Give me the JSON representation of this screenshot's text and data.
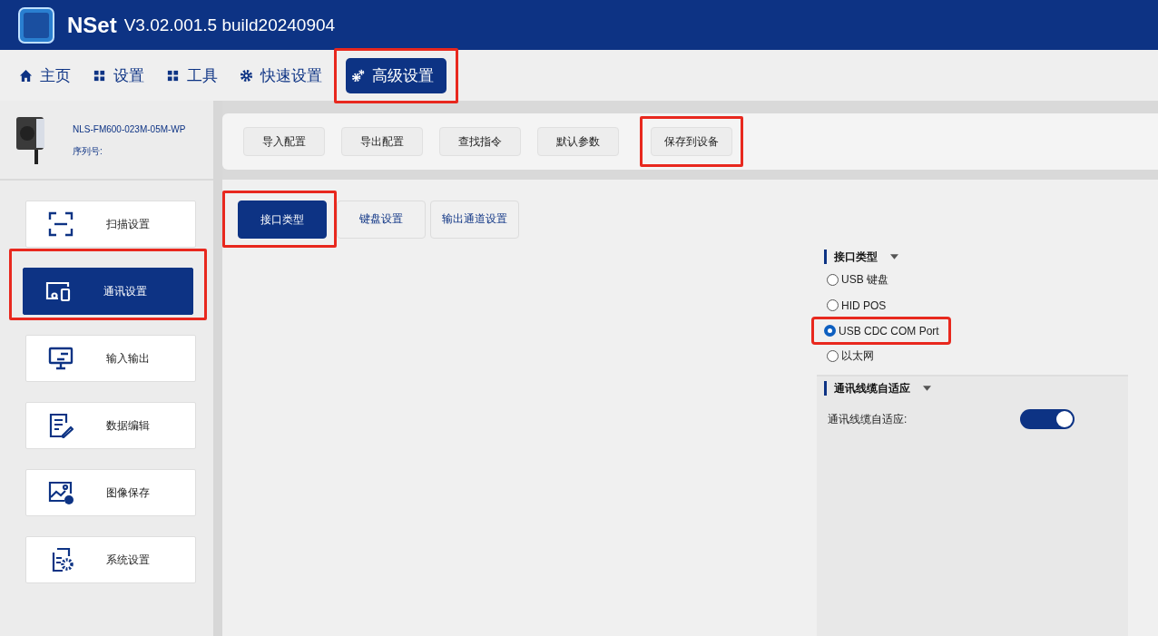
{
  "window": {
    "app_name": "NSet",
    "version": "V3.02.001.5 build20240904"
  },
  "nav": [
    {
      "kind": "home",
      "label": "主页",
      "selected": false,
      "highlighted": false
    },
    {
      "kind": "grid",
      "label": "设置",
      "selected": false,
      "highlighted": false
    },
    {
      "kind": "grid",
      "label": "工具",
      "selected": false,
      "highlighted": false
    },
    {
      "kind": "gear",
      "label": "快速设置",
      "selected": false,
      "highlighted": false
    },
    {
      "kind": "gears",
      "label": "高级设置",
      "selected": true,
      "highlighted": true
    }
  ],
  "device": {
    "model": "NLS-FM600-023M-05M-WP",
    "serial_label": "序列号:"
  },
  "sidebar": {
    "items": [
      {
        "kind": "scan",
        "label": "扫描设置",
        "selected": false,
        "highlighted": false
      },
      {
        "kind": "comm",
        "label": "通讯设置",
        "selected": true,
        "highlighted": true
      },
      {
        "kind": "io",
        "label": "输入输出",
        "selected": false,
        "highlighted": false
      },
      {
        "kind": "edit",
        "label": "数据编辑",
        "selected": false,
        "highlighted": false
      },
      {
        "kind": "image",
        "label": "图像保存",
        "selected": false,
        "highlighted": false
      },
      {
        "kind": "system",
        "label": "系统设置",
        "selected": false,
        "highlighted": false
      }
    ]
  },
  "toolbar": [
    {
      "label": "导入配置",
      "highlighted": false
    },
    {
      "label": "导出配置",
      "highlighted": false
    },
    {
      "label": "查找指令",
      "highlighted": false
    },
    {
      "label": "默认参数",
      "highlighted": false
    },
    {
      "label": "保存到设备",
      "highlighted": true
    }
  ],
  "tabs": [
    {
      "label": "接口类型",
      "selected": true,
      "highlighted": true
    },
    {
      "label": "键盘设置",
      "selected": false,
      "highlighted": false
    },
    {
      "label": "输出通道设置",
      "selected": false,
      "highlighted": false
    }
  ],
  "panel": {
    "interface": {
      "title": "接口类型",
      "options": [
        {
          "label": "USB 键盘",
          "selected": false,
          "highlighted": false
        },
        {
          "label": "HID POS",
          "selected": false,
          "highlighted": false
        },
        {
          "label": "USB CDC COM Port",
          "selected": true,
          "highlighted": true
        },
        {
          "label": "以太网",
          "selected": false,
          "highlighted": false
        }
      ]
    },
    "cable": {
      "title": "通讯线缆自适应",
      "label": "通讯线缆自适应:",
      "on": true
    }
  }
}
